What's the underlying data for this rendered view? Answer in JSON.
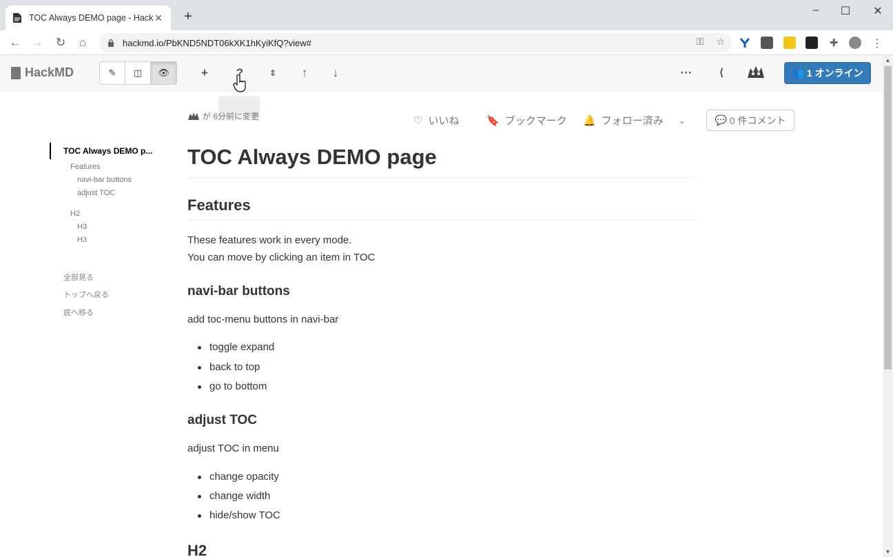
{
  "browser": {
    "tab_title": "TOC Always DEMO page - HackM",
    "url": "hackmd.io/PbKND5NDT06kXK1hKyiKfQ?view#"
  },
  "app": {
    "brand": "HackMD",
    "online_label": "1 オンライン",
    "accent_color": "#337ab7"
  },
  "meta": {
    "changed": "が 6分前に変更",
    "like": "いいね",
    "bookmark": "ブックマーク",
    "follow": "フォロー済み",
    "comments": "0 件コメント"
  },
  "toc": {
    "items": [
      {
        "label": "TOC Always DEMO p...",
        "level": 1
      },
      {
        "label": "Features",
        "level": 2
      },
      {
        "label": "navi-bar buttons",
        "level": 3
      },
      {
        "label": "adjust TOC",
        "level": 3
      },
      {
        "label": "H2",
        "level": 2
      },
      {
        "label": "H3",
        "level": 3
      },
      {
        "label": "H3",
        "level": 3
      }
    ],
    "links": [
      "全部見る",
      "トップへ戻る",
      "底へ移る"
    ]
  },
  "doc": {
    "title": "TOC Always DEMO page",
    "features_heading": "Features",
    "features_p1": "These features work in every mode.",
    "features_p2": "You can move by clicking an item in TOC",
    "navbar_heading": "navi-bar buttons",
    "navbar_p": "add toc-menu buttons in navi-bar",
    "navbar_list": [
      "toggle expand",
      "back to top",
      "go to bottom"
    ],
    "adjust_heading": "adjust TOC",
    "adjust_p": "adjust TOC in menu",
    "adjust_list": [
      "change opacity",
      "change width",
      "hide/show TOC"
    ],
    "h2_heading": "H2"
  }
}
